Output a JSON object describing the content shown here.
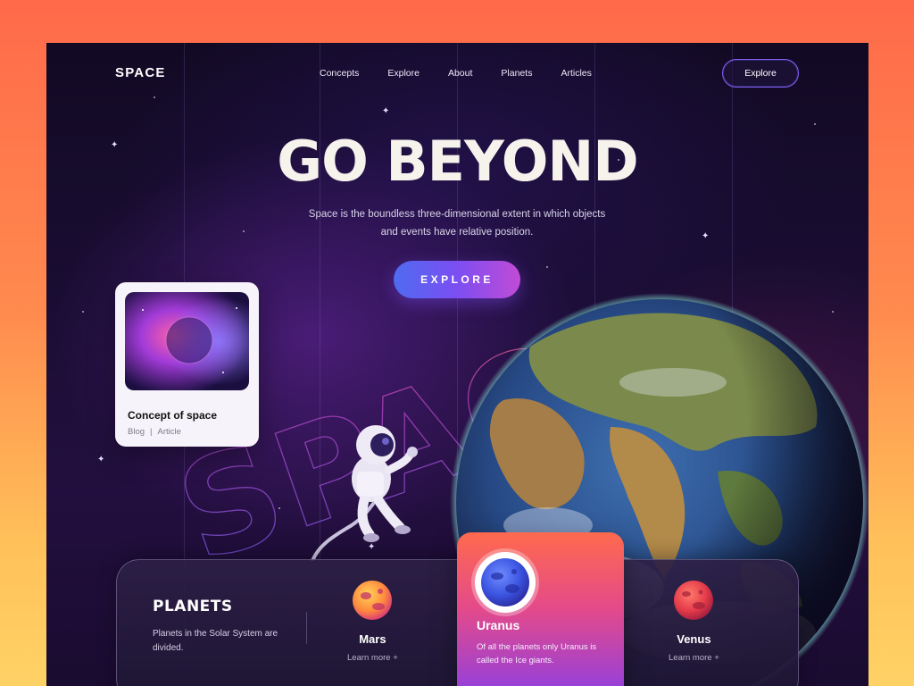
{
  "header": {
    "logo": "SPACE",
    "nav": [
      "Concepts",
      "Explore",
      "About",
      "Planets",
      "Articles"
    ],
    "cta_label": "Explore"
  },
  "hero": {
    "title": "GO BEYOND",
    "description_line1": "Space is the boundless three-dimensional extent in which objects",
    "description_line2": "and events have relative position.",
    "button_label": "EXPLORE",
    "background_word": "SPACE"
  },
  "concept_card": {
    "title": "Concept of space",
    "category": "Blog",
    "separator": "|",
    "type": "Article"
  },
  "planets": {
    "title": "PLANETS",
    "description": "Planets in the Solar System are divided.",
    "items": [
      {
        "name": "Mars",
        "link": "Learn more",
        "link_icon": "+"
      },
      {
        "name": "Uranus",
        "description": "Of all the planets only Uranus is called the Ice giants."
      },
      {
        "name": "Venus",
        "link": "Learn more",
        "link_icon": "+"
      }
    ]
  },
  "colors": {
    "accent_blue": "#4f6bf0",
    "accent_purple": "#7c4ef2",
    "accent_pink": "#c14bd6",
    "uranus_card_top": "#ff6a4d",
    "uranus_card_bottom": "#8a3ee6"
  }
}
